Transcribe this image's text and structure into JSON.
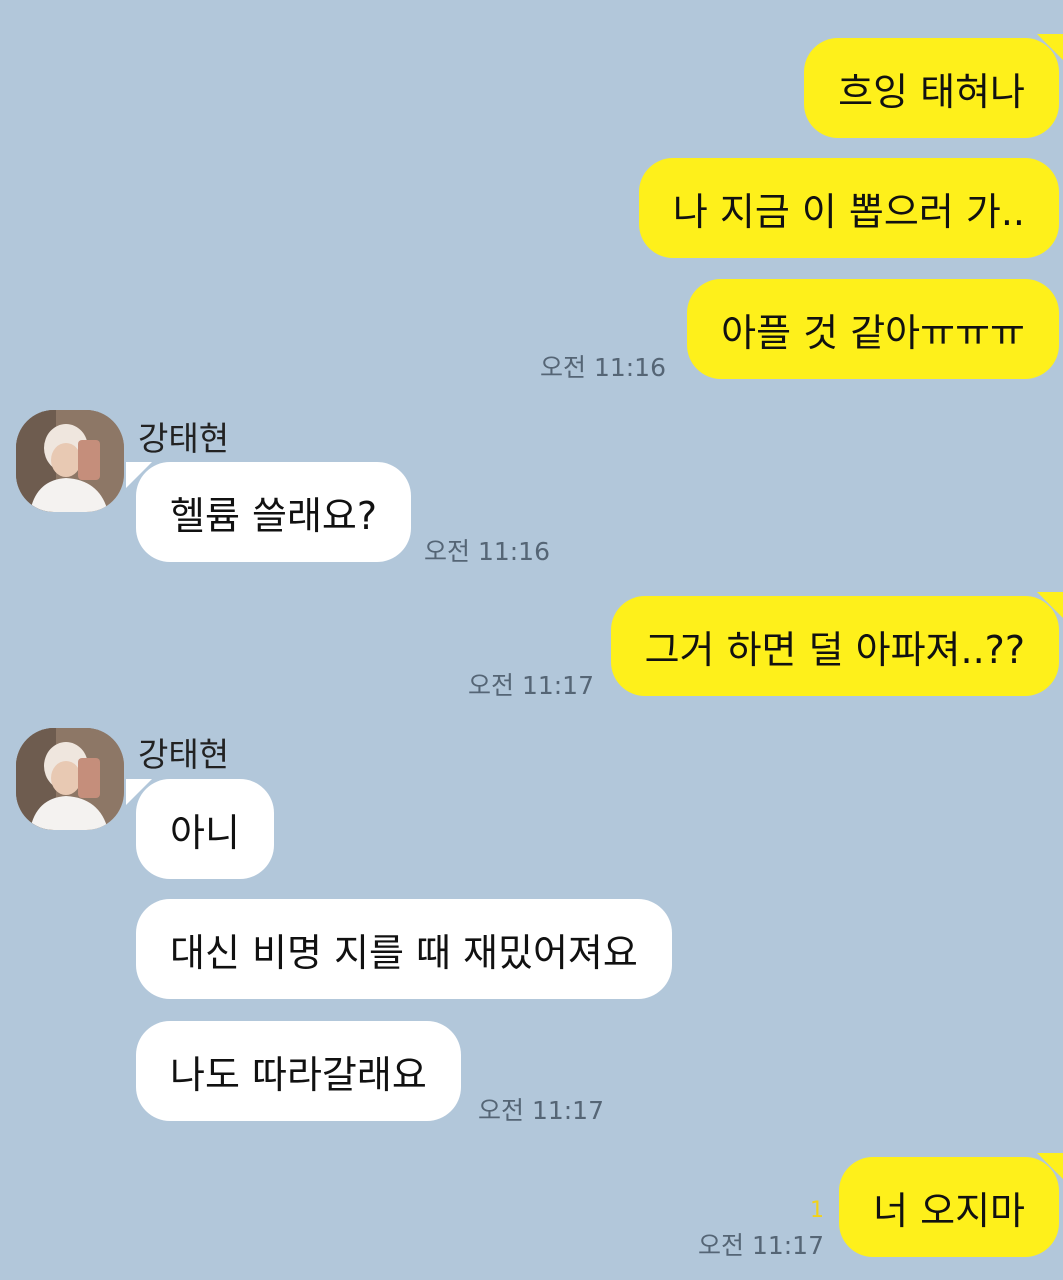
{
  "colors": {
    "background": "#b2c7da",
    "my_bubble": "#fef01b",
    "their_bubble": "#ffffff",
    "timestamp": "#556575",
    "unread": "#f2d21a"
  },
  "contact": {
    "name": "강태현"
  },
  "messages": [
    {
      "text": "흐잉 태혀나"
    },
    {
      "text": "나 지금 이 뽑으러 가.."
    },
    {
      "text": "아플 것 같아ㅠㅠㅠ",
      "time": "오전 11:16"
    },
    {
      "text": "헬륨 쓸래요?",
      "time": "오전 11:16"
    },
    {
      "text": "그거 하면 덜 아파져..??",
      "time": "오전 11:17"
    },
    {
      "text": "아니"
    },
    {
      "text": "대신 비명 지를 때 재밌어져요"
    },
    {
      "text": "나도 따라갈래요",
      "time": "오전 11:17"
    },
    {
      "text": "너 오지마",
      "time": "오전 11:17",
      "unread": "1"
    }
  ]
}
